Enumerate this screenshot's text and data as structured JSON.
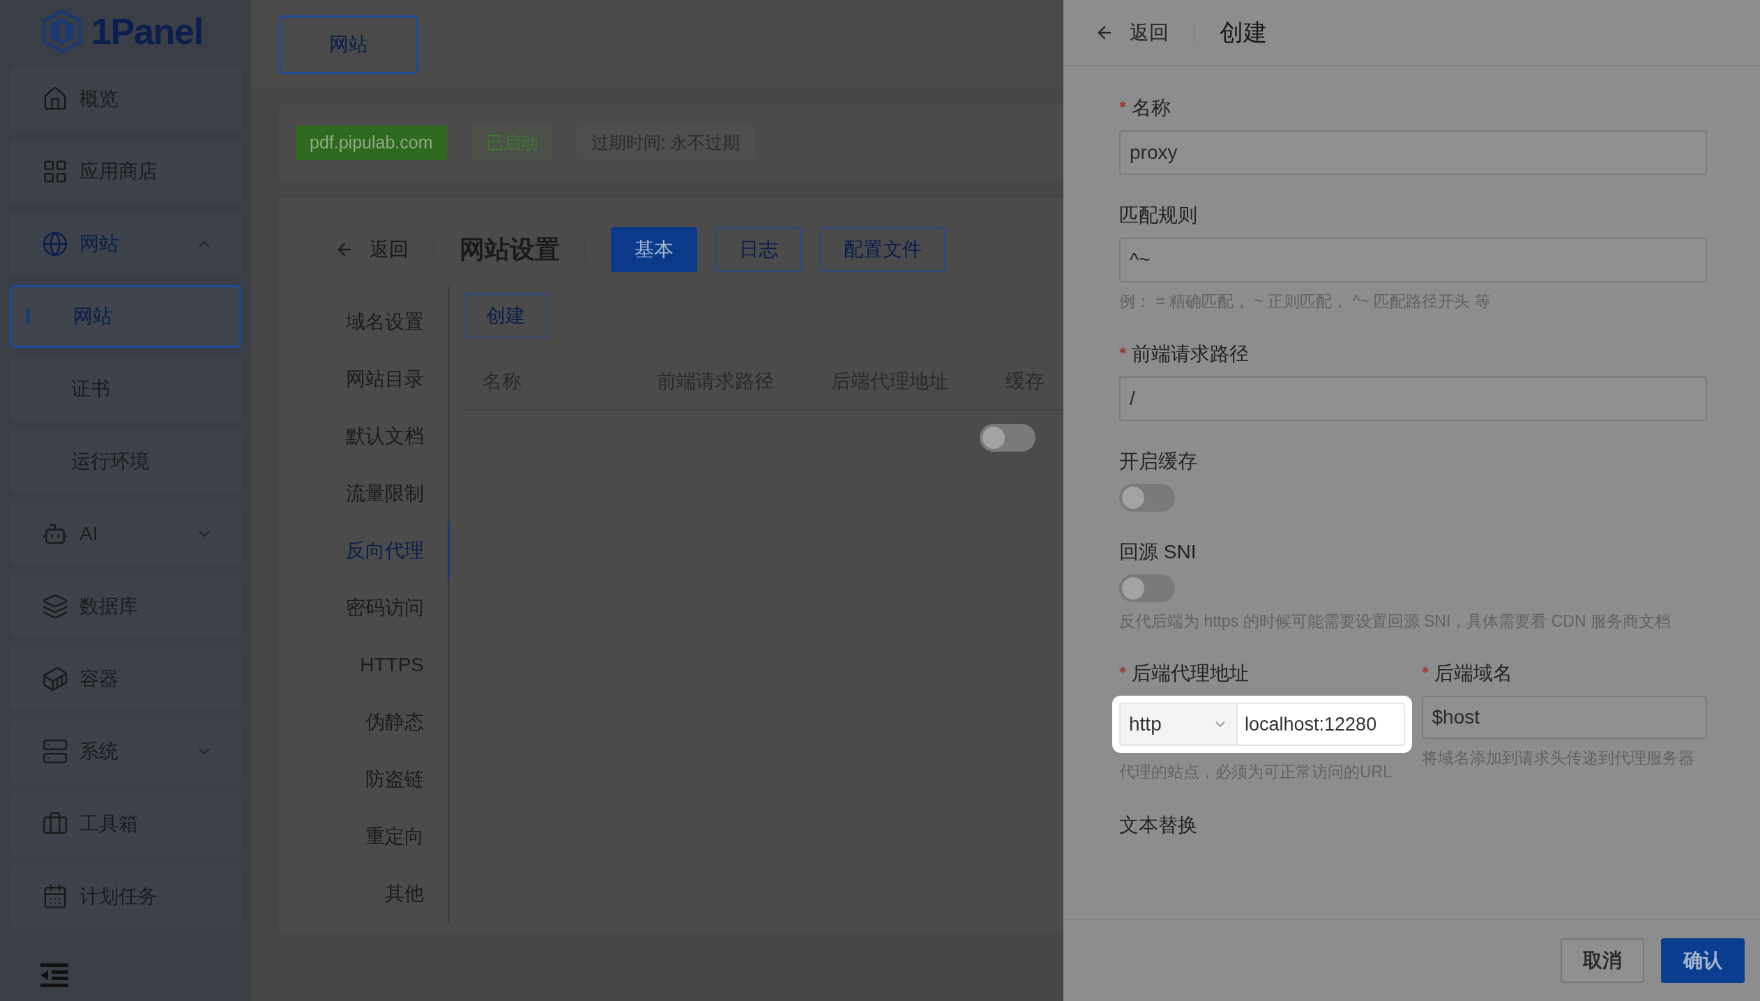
{
  "sidebar": {
    "logo": "1Panel",
    "items": [
      {
        "label": "概览",
        "selected": false
      },
      {
        "label": "应用商店",
        "selected": false
      },
      {
        "label": "网站",
        "selected": true,
        "expanded": true,
        "children": [
          {
            "label": "网站",
            "selected": true
          },
          {
            "label": "证书",
            "selected": false
          },
          {
            "label": "运行环境",
            "selected": false
          }
        ]
      },
      {
        "label": "AI",
        "selected": false,
        "expanded": false
      },
      {
        "label": "数据库",
        "selected": false
      },
      {
        "label": "容器",
        "selected": false
      },
      {
        "label": "系统",
        "selected": false,
        "expanded": false
      },
      {
        "label": "工具箱",
        "selected": false
      },
      {
        "label": "计划任务",
        "selected": false
      }
    ]
  },
  "main": {
    "top_button": "网站",
    "site_tags": [
      {
        "text": "pdf.pipulab.com",
        "kind": "domain"
      },
      {
        "text": "已启动",
        "kind": "status"
      },
      {
        "text": "过期时间: 永不过期",
        "kind": "info"
      }
    ],
    "settings": {
      "back": "返回",
      "title": "网站设置",
      "tabs": [
        {
          "label": "基本",
          "selected": true
        },
        {
          "label": "日志",
          "selected": false
        },
        {
          "label": "配置文件",
          "selected": false
        }
      ],
      "menu": [
        {
          "label": "域名设置",
          "selected": false
        },
        {
          "label": "网站目录",
          "selected": false
        },
        {
          "label": "默认文档",
          "selected": false
        },
        {
          "label": "流量限制",
          "selected": false
        },
        {
          "label": "反向代理",
          "selected": true
        },
        {
          "label": "密码访问",
          "selected": false
        },
        {
          "label": "HTTPS",
          "selected": false
        },
        {
          "label": "伪静态",
          "selected": false
        },
        {
          "label": "防盗链",
          "selected": false
        },
        {
          "label": "重定向",
          "selected": false
        },
        {
          "label": "其他",
          "selected": false
        }
      ],
      "create_button": "创建",
      "table": {
        "columns": [
          "名称",
          "前端请求路径",
          "后端代理地址",
          "缓存"
        ],
        "rows": [
          {
            "cache_on": false
          }
        ]
      }
    }
  },
  "drawer": {
    "back": "返回",
    "title": "创建",
    "fields": [
      {
        "kind": "input",
        "label": "名称",
        "required": true,
        "value": "proxy"
      },
      {
        "kind": "input",
        "label": "匹配规则",
        "required": false,
        "value": "^~",
        "hint": "例： = 精确匹配， ~ 正则匹配， ^~ 匹配路径开头 等"
      },
      {
        "kind": "input",
        "label": "前端请求路径",
        "required": true,
        "value": "/"
      },
      {
        "kind": "switch",
        "label": "开启缓存",
        "on": false
      },
      {
        "kind": "switch",
        "label": "回源 SNI",
        "on": false,
        "hint": "反代后端为 https 的时候可能需要设置回源 SNI，具体需要看 CDN 服务商文档"
      },
      {
        "kind": "pair",
        "items": [
          {
            "label": "后端代理地址",
            "required": true,
            "scheme": "http",
            "value": "localhost:12280",
            "hint": "代理的站点，必须为可正常访问的URL",
            "highlighted": true
          },
          {
            "label": "后端域名",
            "required": true,
            "value": "$host",
            "hint": "将域名添加到请求头传递到代理服务器",
            "highlighted": false
          }
        ]
      },
      {
        "kind": "heading",
        "label": "文本替换"
      }
    ],
    "buttons": [
      {
        "label": "取消",
        "kind": "secondary"
      },
      {
        "label": "确认",
        "kind": "primary"
      }
    ]
  }
}
